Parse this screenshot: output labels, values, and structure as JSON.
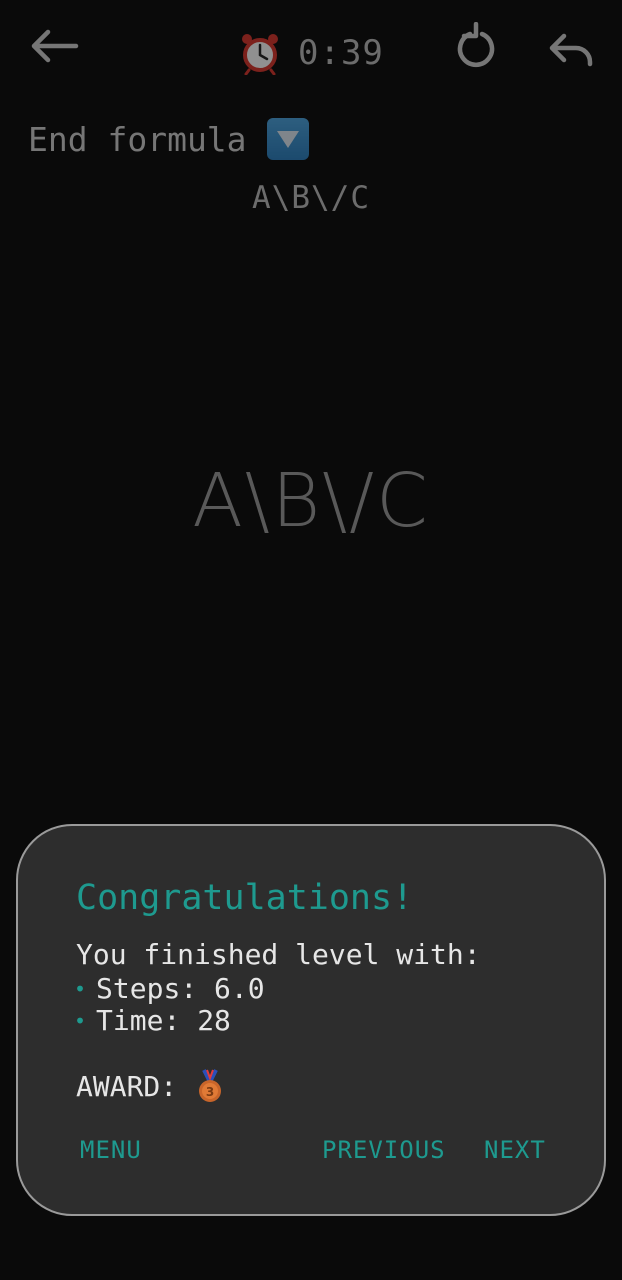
{
  "header": {
    "timer": "0:39"
  },
  "end_formula": {
    "label": "End formula",
    "target": "A\\B\\/C"
  },
  "main": {
    "current_formula": "A\\B\\/C"
  },
  "dialog": {
    "title": "Congratulations!",
    "subtitle": "You finished level with:",
    "steps": "Steps: 6.0",
    "time": "Time: 28",
    "award_label": "AWARD:",
    "award_icon": "bronze-medal-icon",
    "menu_label": "MENU",
    "previous_label": "PREVIOUS",
    "next_label": "NEXT"
  },
  "colors": {
    "accent": "#1e9a8f",
    "dialog_bg": "#2d2d2d",
    "page_bg": "#0a0a0a"
  }
}
